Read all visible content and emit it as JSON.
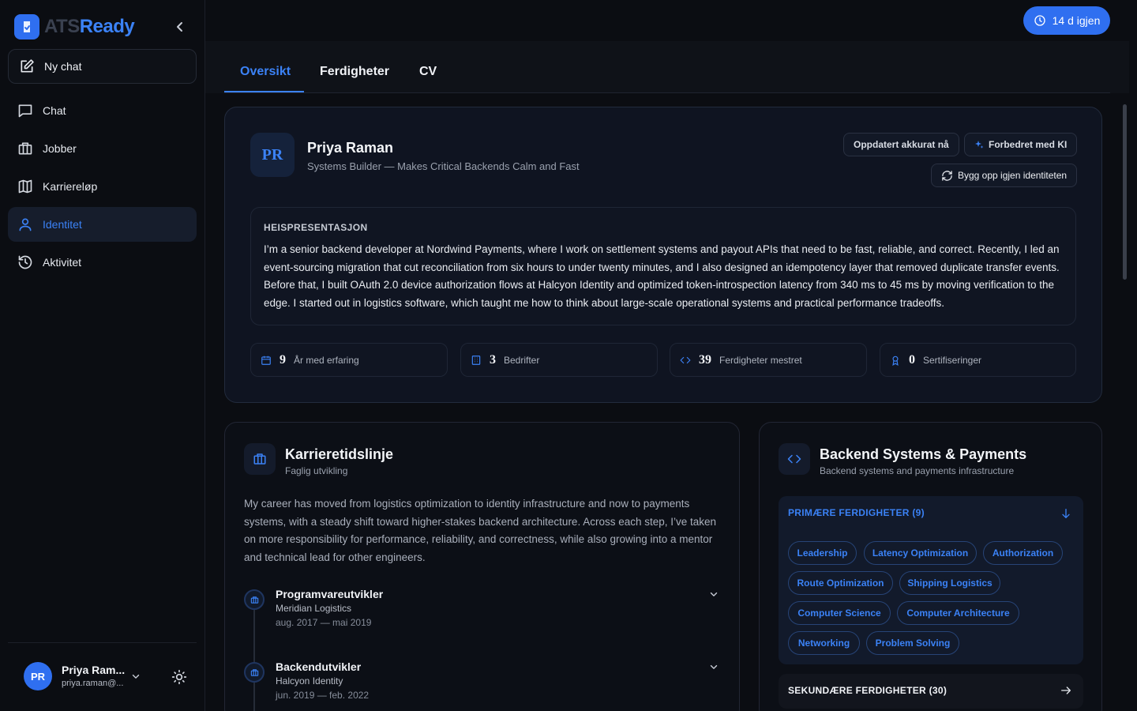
{
  "brand": {
    "part1": "ATS",
    "part2": "Ready",
    "accent": "#3b82f6"
  },
  "sidebar": {
    "new_chat": "Ny chat",
    "items": [
      {
        "label": "Chat",
        "icon": "chat-icon"
      },
      {
        "label": "Jobber",
        "icon": "briefcase-icon"
      },
      {
        "label": "Karriereløp",
        "icon": "map-icon"
      },
      {
        "label": "Identitet",
        "icon": "user-icon",
        "active": true
      },
      {
        "label": "Aktivitet",
        "icon": "history-icon"
      }
    ],
    "user": {
      "initials": "PR",
      "name": "Priya Ram...",
      "email": "priya.raman@..."
    }
  },
  "topbar": {
    "trial": "14 d igjen"
  },
  "tabs": [
    "Oversikt",
    "Ferdigheter",
    "CV"
  ],
  "profile": {
    "initials": "PR",
    "name": "Priya Raman",
    "tagline": "Systems Builder — Makes Critical Backends Calm and Fast",
    "updated": "Oppdatert akkurat nå",
    "enhanced": "Forbedret med KI",
    "rebuild": "Bygg opp igjen identiteten",
    "pitch_heading": "HEISPRESENTASJON",
    "pitch_text": "I’m a senior backend developer at Nordwind Payments, where I work on settlement systems and payout APIs that need to be fast, reliable, and correct. Recently, I led an event-sourcing migration that cut reconciliation from six hours to under twenty minutes, and I also designed an idempotency layer that removed duplicate transfer events. Before that, I built OAuth 2.0 device authorization flows at Halcyon Identity and optimized token-introspection latency from 340 ms to 45 ms by moving verification to the edge. I started out in logistics software, which taught me how to think about large-scale operational systems and practical performance tradeoffs.",
    "stats": [
      {
        "value": "9",
        "label": "År med erfaring",
        "icon": "calendar-icon"
      },
      {
        "value": "3",
        "label": "Bedrifter",
        "icon": "building-icon"
      },
      {
        "value": "39",
        "label": "Ferdigheter mestret",
        "icon": "code-icon"
      },
      {
        "value": "0",
        "label": "Sertifiseringer",
        "icon": "award-icon"
      }
    ]
  },
  "career": {
    "title": "Karrieretidslinje",
    "subtitle": "Faglig utvikling",
    "summary": "My career has moved from logistics optimization to identity infrastructure and now to payments systems, with a steady shift toward higher-stakes backend architecture. Across each step, I’ve taken on more responsibility for performance, reliability, and correctness, while also growing into a mentor and technical lead for other engineers.",
    "entries": [
      {
        "title": "Programvareutvikler",
        "company": "Meridian Logistics",
        "dates": "aug. 2017 — mai 2019"
      },
      {
        "title": "Backendutvikler",
        "company": "Halcyon Identity",
        "dates": "jun. 2019 — feb. 2022"
      }
    ]
  },
  "skills": {
    "title": "Backend Systems & Payments",
    "subtitle": "Backend systems and payments infrastructure",
    "primary_heading": "PRIMÆRE FERDIGHETER (9)",
    "primary": [
      "Leadership",
      "Latency Optimization",
      "Authorization",
      "Route Optimization",
      "Shipping Logistics",
      "Computer Science",
      "Computer Architecture",
      "Networking",
      "Problem Solving"
    ],
    "secondary_heading": "SEKUNDÆRE FERDIGHETER (30)"
  }
}
